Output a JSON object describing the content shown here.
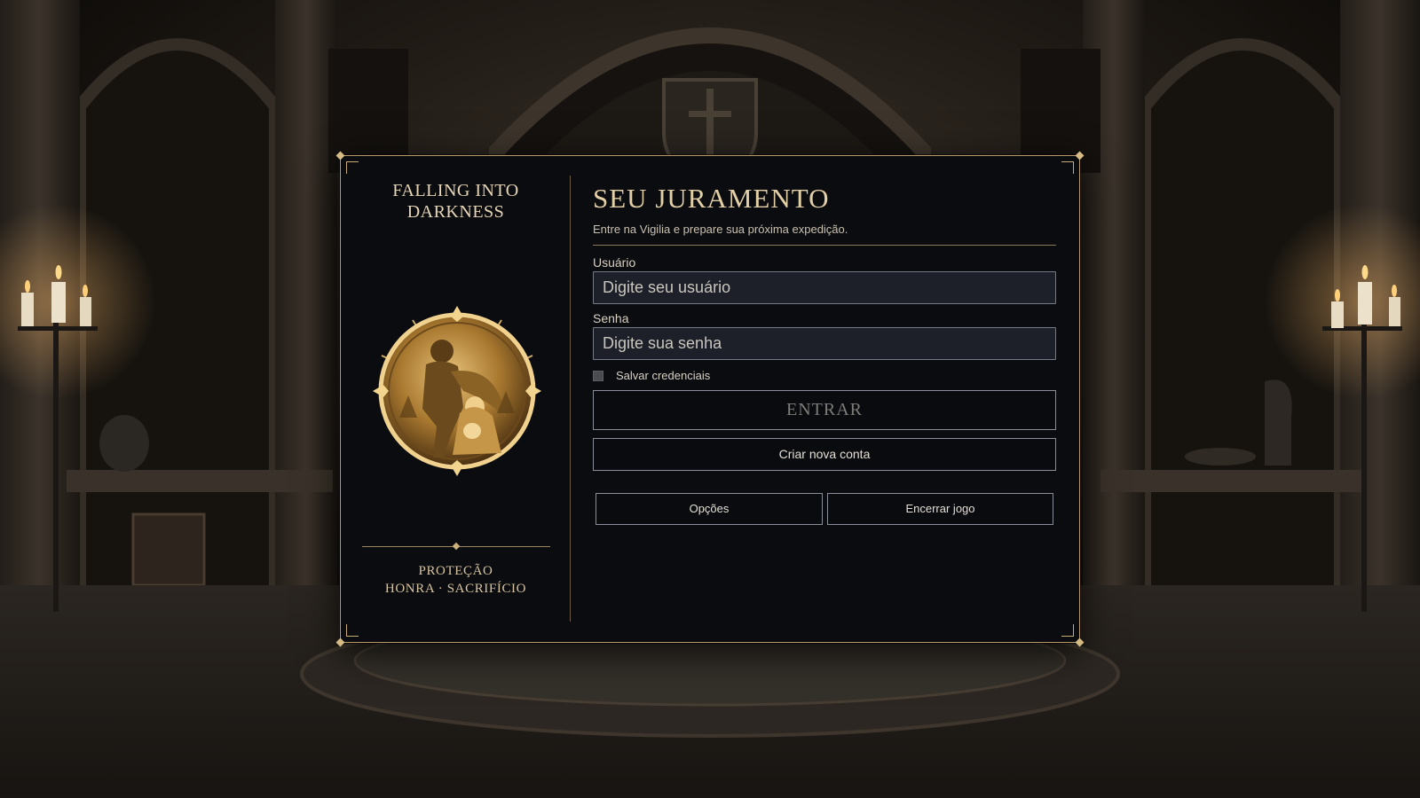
{
  "game": {
    "title": "FALLING INTO\nDARKNESS",
    "motto_line1": "PROTEÇÃO",
    "motto_line2": "HONRA · SACRIFÍCIO",
    "emblem_icon": "knight-and-mother-medallion-icon"
  },
  "login": {
    "title": "SEU JURAMENTO",
    "subtitle": "Entre na Vigilia e prepare sua próxima expedição.",
    "username": {
      "label": "Usuário",
      "value": "",
      "placeholder": "Digite seu usuário"
    },
    "password": {
      "label": "Senha",
      "value": "",
      "placeholder": "Digite sua senha"
    },
    "remember": {
      "label": "Salvar credenciais",
      "checked": false
    },
    "enter_label": "ENTRAR",
    "create_label": "Criar nova conta",
    "options_label": "Opções",
    "quit_label": "Encerrar jogo"
  },
  "theme": {
    "accent": "#c7aa74",
    "panel_bg": "#0b0c10",
    "field_bg": "#1d2028",
    "title_color": "#e3cfa6"
  }
}
